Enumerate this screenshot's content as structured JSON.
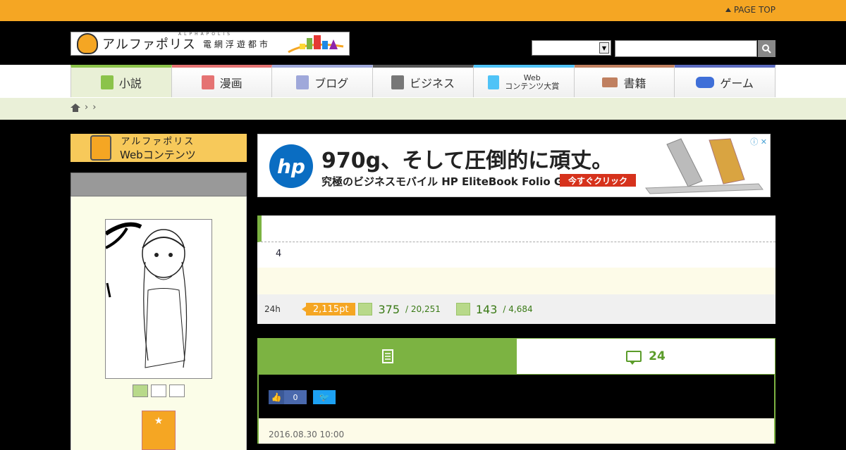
{
  "topbar": {
    "page_top": "PAGE TOP"
  },
  "header": {
    "logo_kana": "アルファポリス",
    "logo_sub": "電網浮遊都市",
    "logo_tiny": "ALPHAPOLIS",
    "select_value": "",
    "search_placeholder": ""
  },
  "nav": {
    "items": [
      {
        "label": "小説",
        "color": "#8bc34a"
      },
      {
        "label": "漫画",
        "color": "#e57373"
      },
      {
        "label": "ブログ",
        "color": "#9fa8da"
      },
      {
        "label": "ビジネス",
        "color": "#555555"
      },
      {
        "label1": "Web",
        "label2": "コンテンツ大賞",
        "color": "#4fc3f7"
      },
      {
        "label": "書籍",
        "color": "#c08060"
      },
      {
        "label": "ゲーム",
        "color": "#5c6bc0"
      }
    ]
  },
  "breadcrumb": {
    "sep1": "›",
    "sep2": "›"
  },
  "sidebar": {
    "banner_line1": "アルファポリス",
    "banner_line2": "Webコンテンツ",
    "favorite_icon": "star-icon"
  },
  "ad": {
    "brand": "hp",
    "headline": "970g、そして圧倒的に頑丈。",
    "subline": "究極のビジネスモバイル HP EliteBook Folio G1",
    "cta": "今すぐクリック",
    "adchoice": "ⓘ ✕"
  },
  "work": {
    "chapter": "4",
    "stats_period": "24h",
    "points": "2,115pt",
    "rank1": "375",
    "rank1_total": "/ 20,251",
    "rank2": "143",
    "rank2_total": "/ 4,684"
  },
  "tabs": {
    "comments_count": "24"
  },
  "content": {
    "like_count": "0",
    "date": "2016.08.30 10:00"
  }
}
